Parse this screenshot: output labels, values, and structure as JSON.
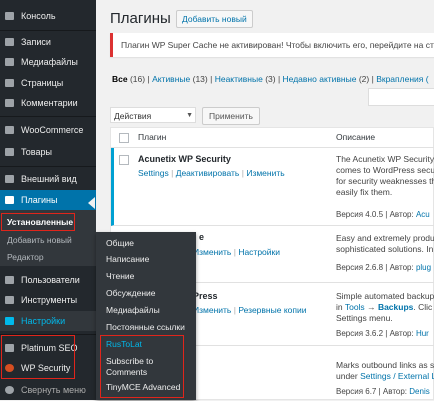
{
  "sidebar": {
    "items": [
      {
        "label": "Консоль",
        "icon": "dashboard-icon"
      },
      {
        "label": "Записи",
        "icon": "pin-icon"
      },
      {
        "label": "Медиафайлы",
        "icon": "media-icon"
      },
      {
        "label": "Страницы",
        "icon": "pages-icon"
      },
      {
        "label": "Комментарии",
        "icon": "comments-icon"
      },
      {
        "label": "WooCommerce",
        "icon": "woocommerce-icon"
      },
      {
        "label": "Товары",
        "icon": "products-icon"
      },
      {
        "label": "Внешний вид",
        "icon": "appearance-icon"
      },
      {
        "label": "Плагины",
        "icon": "plugins-icon"
      },
      {
        "label": "Пользователи",
        "icon": "users-icon"
      },
      {
        "label": "Инструменты",
        "icon": "tools-icon"
      },
      {
        "label": "Настройки",
        "icon": "settings-icon"
      },
      {
        "label": "Platinum SEO",
        "icon": "gear-icon"
      },
      {
        "label": "WP Security",
        "icon": "shield-icon"
      },
      {
        "label": "Свернуть меню",
        "icon": "collapse-icon"
      }
    ],
    "plugins_submenu": [
      "Установленные",
      "Добавить новый",
      "Редактор"
    ]
  },
  "settings_flyout": {
    "items": [
      "Общие",
      "Написание",
      "Чтение",
      "Обсуждение",
      "Медиафайлы",
      "Постоянные ссылки",
      "RusToLat",
      "Subscribe to",
      "Comments",
      "TinyMCE Advanced"
    ]
  },
  "page": {
    "title": "Плагины",
    "add_new": "Добавить новый",
    "notice": "Плагин WP Super Cache не активирован! Чтобы включить его, перейдите на стр"
  },
  "filters": {
    "all": "Все",
    "all_count": "(16)",
    "active": "Активные",
    "active_count": "(13)",
    "inactive": "Неактивные",
    "inactive_count": "(3)",
    "recent": "Недавно активные",
    "recent_count": "(2)",
    "dropins": "Вкрапления (",
    "sep": "|"
  },
  "bulk": {
    "selected": "Действия",
    "apply": "Применить"
  },
  "table": {
    "col_plugin": "Плагин",
    "col_desc": "Описание",
    "rows": [
      {
        "name": "Acunetix WP Security",
        "links": [
          "Settings",
          "|",
          "Деактивировать",
          "|",
          "Изменить"
        ],
        "desc": [
          "The Acunetix WP Security",
          "comes to WordPress secur",
          "for security weaknesses th",
          "easily fix them."
        ],
        "version": "Версия 4.0.5",
        "author_label": "| Автор:",
        "author": "Acu"
      },
      {
        "name": "e",
        "links": [
          "Изменить",
          "|",
          "Настройки"
        ],
        "desc": [
          "Easy and extremely produ",
          "sophisticated solutions. In"
        ],
        "version": "Версия 2.6.8",
        "author_label": "| Автор:",
        "author": "plug"
      },
      {
        "name": "Press",
        "links": [
          "Изменить",
          "|",
          "Резервные копии"
        ],
        "desc_parts": [
          "Simple automated backup",
          "in",
          "Tools",
          "→",
          "Backups",
          ". Clic",
          "Settings menu."
        ],
        "version": "Версия 3.6.2",
        "author_label": "| Автор:",
        "author": "Hur"
      },
      {
        "name": "",
        "links": [],
        "desc_parts": [
          "Marks outbound links as s",
          "under",
          "Settings / External Li"
        ],
        "version": "Версия 6.7",
        "author_label": "| Автор:",
        "author": "Denis"
      }
    ]
  },
  "colors": {
    "sidebar_bg": "#23282d",
    "accent": "#0073aa",
    "highlight_box": "#e0251b"
  }
}
